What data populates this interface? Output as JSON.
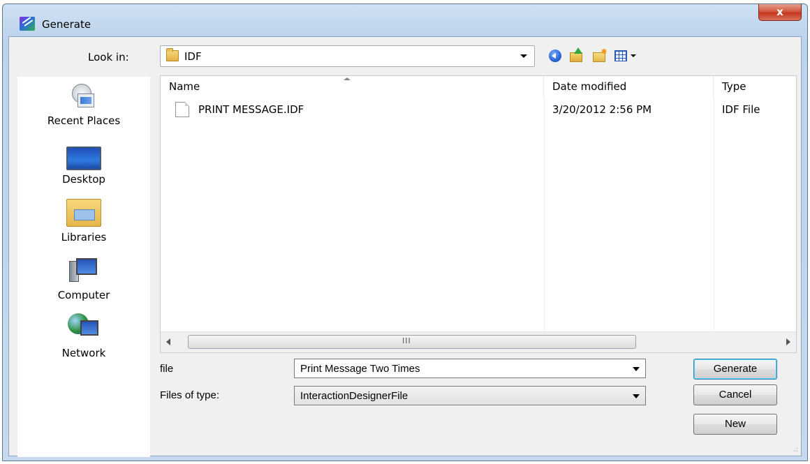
{
  "window": {
    "title": "Generate",
    "close_symbol": "x"
  },
  "lookin": {
    "label": "Look in:",
    "value": "IDF"
  },
  "toolbar": {
    "icons": [
      "back-icon",
      "up-folder-icon",
      "new-folder-icon",
      "view-menu-icon"
    ]
  },
  "places": [
    {
      "label": "Recent Places",
      "icon": "recent-places-icon"
    },
    {
      "label": "Desktop",
      "icon": "desktop-icon"
    },
    {
      "label": "Libraries",
      "icon": "libraries-icon"
    },
    {
      "label": "Computer",
      "icon": "computer-icon"
    },
    {
      "label": "Network",
      "icon": "network-icon"
    }
  ],
  "filelist": {
    "columns": [
      "Name",
      "Date modified",
      "Type"
    ],
    "rows": [
      {
        "name": "PRINT MESSAGE.IDF",
        "date": "3/20/2012 2:56 PM",
        "type": "IDF File"
      }
    ],
    "scroll_grip": "III"
  },
  "form": {
    "file_label": "file",
    "file_value": "Print Message Two Times",
    "type_label": "Files of type:",
    "type_value": "InteractionDesignerFile"
  },
  "buttons": {
    "generate": "Generate",
    "cancel": "Cancel",
    "new": "New"
  },
  "colors": {
    "title_bar": "#c6d9ee",
    "close_button": "#c3381e",
    "dialog_bg": "#f0f0f0",
    "default_button_border": "#3c7fb1"
  }
}
